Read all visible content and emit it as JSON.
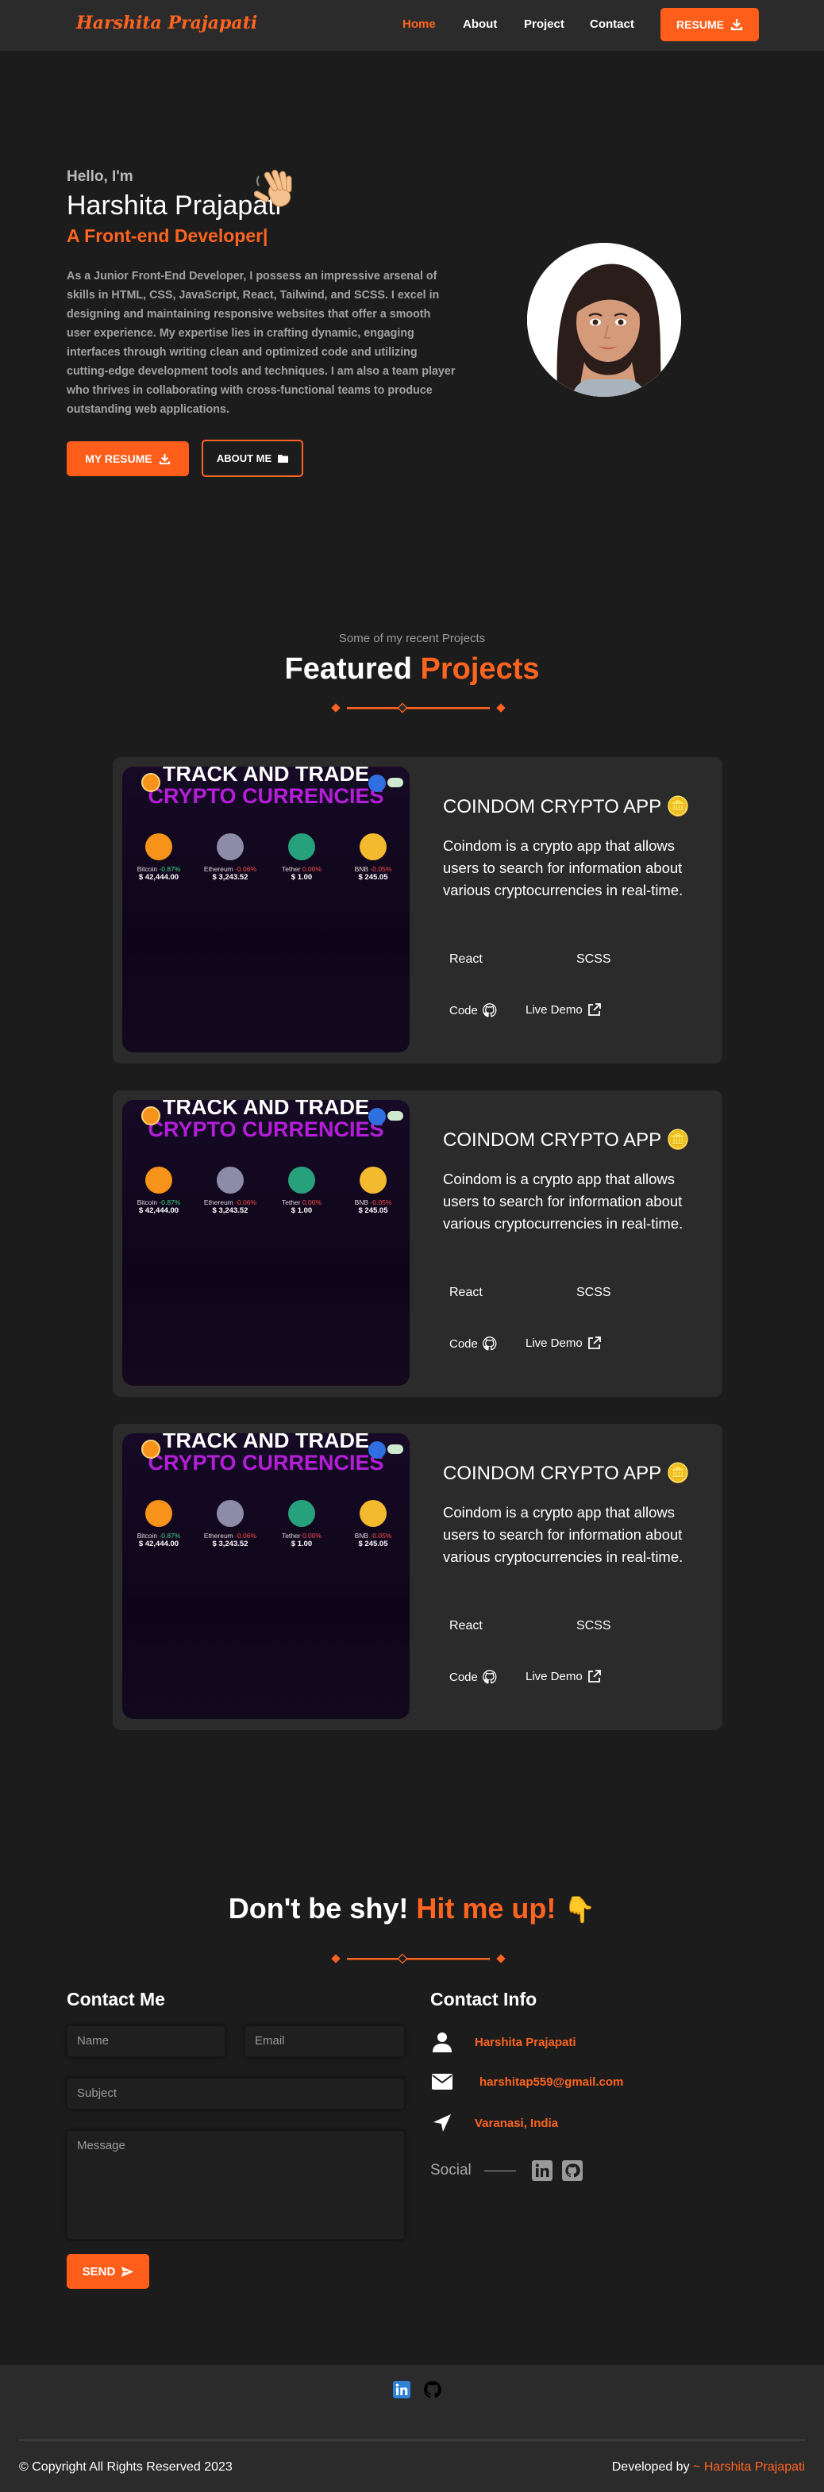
{
  "nav": {
    "logo": "Harshita Prajapati",
    "links": [
      "Home",
      "About",
      "Project",
      "Contact"
    ],
    "resume_label": "RESUME"
  },
  "hero": {
    "greeting": "Hello, I'm",
    "name": "Harshita Prajapati",
    "role": "A Front-end Developer|",
    "bio": "As a Junior Front-End Developer, I possess an impressive arsenal of skills in HTML, CSS, JavaScript, React, Tailwind, and SCSS. I excel in designing and maintaining responsive websites that offer a smooth user experience. My expertise lies in crafting dynamic, engaging interfaces through writing clean and optimized code and utilizing cutting-edge development tools and techniques. I am also a team player who thrives in collaborating with cross-functional teams to produce outstanding web applications.",
    "resume_button": "MY RESUME",
    "about_button": "ABOUT ME"
  },
  "projects": {
    "subtitle": "Some of my recent Projects",
    "title_main": "Featured",
    "title_accent": "Projects",
    "items": [
      {
        "title": "COINDOM CRYPTO APP 🪙",
        "description": "Coindom is a crypto app that allows users to search for information about various cryptocurrencies in real-time.",
        "tech": [
          "React",
          "SCSS"
        ],
        "code_label": "Code",
        "demo_label": "Live Demo"
      },
      {
        "title": "COINDOM CRYPTO APP 🪙",
        "description": "Coindom is a crypto app that allows users to search for information about various cryptocurrencies in real-time.",
        "tech": [
          "React",
          "SCSS"
        ],
        "code_label": "Code",
        "demo_label": "Live Demo"
      },
      {
        "title": "COINDOM CRYPTO APP 🪙",
        "description": "Coindom is a crypto app that allows users to search for information about various cryptocurrencies in real-time.",
        "tech": [
          "React",
          "SCSS"
        ],
        "code_label": "Code",
        "demo_label": "Live Demo"
      }
    ],
    "screenshot": {
      "headline1": "TRACK AND TRADE",
      "headline2": "CRYPTO CURRENCIES",
      "coins": [
        {
          "name": "Bitcoin",
          "change": "-0.87%",
          "change_color": "#3ddc84",
          "price": "$ 42,444.00",
          "color": "#f7931a"
        },
        {
          "name": "Ethereum",
          "change": "-0.06%",
          "change_color": "#ff4d4d",
          "price": "$ 3,243.52",
          "color": "#8c8ca8"
        },
        {
          "name": "Tether",
          "change": "0.00%",
          "change_color": "#ff4d4d",
          "price": "$ 1.00",
          "color": "#26a17b"
        },
        {
          "name": "BNB",
          "change": "-0.05%",
          "change_color": "#ff4d4d",
          "price": "$ 245.05",
          "color": "#f3ba2f"
        }
      ]
    }
  },
  "contact": {
    "title_main": "Don't be shy!",
    "title_accent": "Hit me up!",
    "title_emoji": "👇",
    "form_heading": "Contact Me",
    "placeholders": {
      "name": "Name",
      "email": "Email",
      "subject": "Subject",
      "message": "Message"
    },
    "send_label": "SEND",
    "info_heading": "Contact Info",
    "info": {
      "name": "Harshita Prajapati",
      "email": "harshitap559@gmail.com",
      "location": "Varanasi, India"
    },
    "social_label": "Social"
  },
  "footer": {
    "copyright": "© Copyright All Rights Reserved 2023",
    "developed_by": "Developed by",
    "developer": "~ Harshita Prajapati"
  },
  "colors": {
    "accent": "#ff6420",
    "background": "#1c1c1c",
    "panel": "#2b2b2b"
  }
}
